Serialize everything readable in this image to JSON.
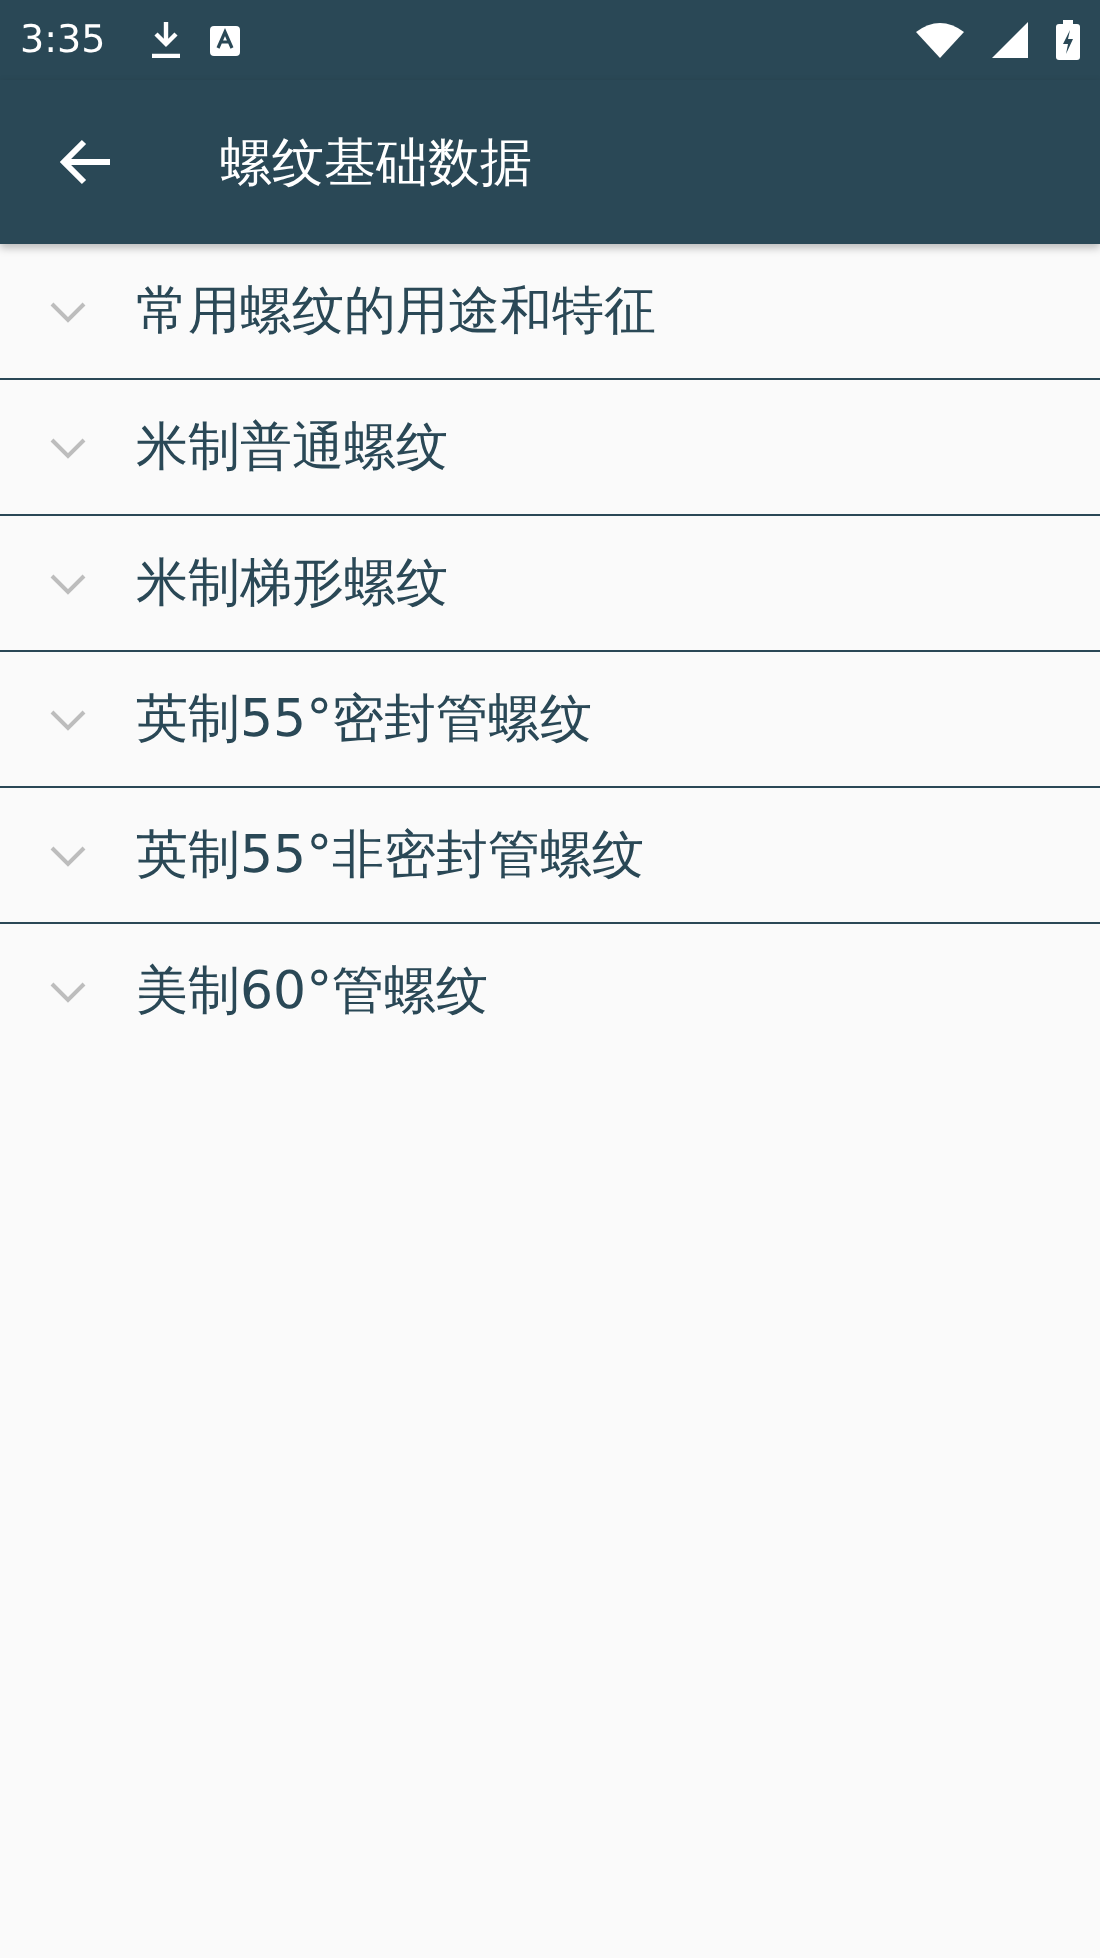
{
  "status_bar": {
    "time": "3:35"
  },
  "app_bar": {
    "title": "螺纹基础数据"
  },
  "sections": [
    {
      "title": "常用螺纹的用途和特征",
      "expanded": false
    },
    {
      "title": "米制普通螺纹",
      "expanded": false
    },
    {
      "title": "米制梯形螺纹",
      "expanded": false
    },
    {
      "title": "英制55°密封管螺纹",
      "expanded": false
    },
    {
      "title": "英制55°非密封管螺纹",
      "expanded": false
    },
    {
      "title": "美制60°管螺纹",
      "expanded": false
    }
  ]
}
